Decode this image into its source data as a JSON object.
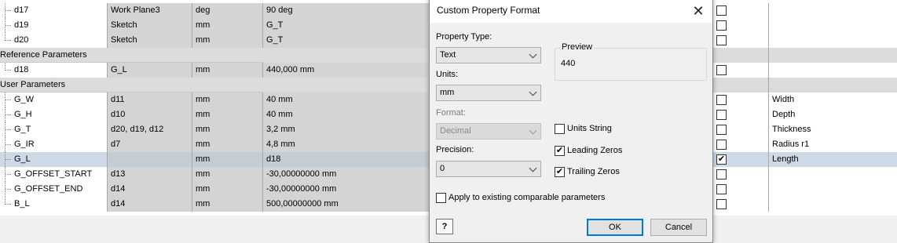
{
  "grid": {
    "rows": [
      {
        "kind": "param",
        "name": "d17",
        "unit": "Work Plane3",
        "type": "deg",
        "equation": "90 deg",
        "checked": false,
        "comment": ""
      },
      {
        "kind": "param",
        "name": "d19",
        "unit": "Sketch",
        "type": "mm",
        "equation": "G_T",
        "checked": false,
        "comment": ""
      },
      {
        "kind": "param",
        "name": "d20",
        "unit": "Sketch",
        "type": "mm",
        "equation": "G_T",
        "checked": false,
        "comment": "",
        "last": true
      },
      {
        "kind": "group",
        "label": "Reference Parameters"
      },
      {
        "kind": "param",
        "name": "d18",
        "unit": "G_L",
        "type": "mm",
        "equation": "440,000 mm",
        "checked": false,
        "comment": "",
        "last": true
      },
      {
        "kind": "group",
        "label": "User Parameters"
      },
      {
        "kind": "param",
        "name": "G_W",
        "unit": "d11",
        "type": "mm",
        "equation": "40 mm",
        "checked": false,
        "comment": "Width"
      },
      {
        "kind": "param",
        "name": "G_H",
        "unit": "d10",
        "type": "mm",
        "equation": "40 mm",
        "checked": false,
        "comment": "Depth"
      },
      {
        "kind": "param",
        "name": "G_T",
        "unit": "d20, d19, d12",
        "type": "mm",
        "equation": "3,2 mm",
        "checked": false,
        "comment": "Thickness"
      },
      {
        "kind": "param",
        "name": "G_IR",
        "unit": "d7",
        "type": "mm",
        "equation": "4,8 mm",
        "checked": false,
        "comment": "Radius r1"
      },
      {
        "kind": "param",
        "name": "G_L",
        "unit": "",
        "type": "mm",
        "equation": "d18",
        "checked": true,
        "comment": "Length",
        "selected": true
      },
      {
        "kind": "param",
        "name": "G_OFFSET_START",
        "unit": "d13",
        "type": "mm",
        "equation": "-30,00000000 mm",
        "checked": false,
        "comment": ""
      },
      {
        "kind": "param",
        "name": "G_OFFSET_END",
        "unit": "d14",
        "type": "mm",
        "equation": "-30,00000000 mm",
        "checked": false,
        "comment": ""
      },
      {
        "kind": "param",
        "name": "B_L",
        "unit": "d14",
        "type": "mm",
        "equation": "500,00000000 mm",
        "checked": false,
        "comment": "",
        "last": true
      }
    ]
  },
  "dialog": {
    "title": "Custom Property Format",
    "close_glyph": "✕",
    "property_type_label": "Property Type:",
    "property_type_value": "Text",
    "units_label": "Units:",
    "units_value": "mm",
    "format_label": "Format:",
    "format_value": "Decimal",
    "precision_label": "Precision:",
    "precision_value": "0",
    "preview_label": "Preview",
    "preview_value": "440",
    "units_string_label": "Units String",
    "units_string_checked": false,
    "leading_zeros_label": "Leading Zeros",
    "leading_zeros_checked": true,
    "trailing_zeros_label": "Trailing Zeros",
    "trailing_zeros_checked": true,
    "apply_label": "Apply to existing comparable parameters",
    "apply_checked": false,
    "ok_label": "OK",
    "cancel_label": "Cancel",
    "help_glyph": "?"
  },
  "check_glyph": "✔"
}
